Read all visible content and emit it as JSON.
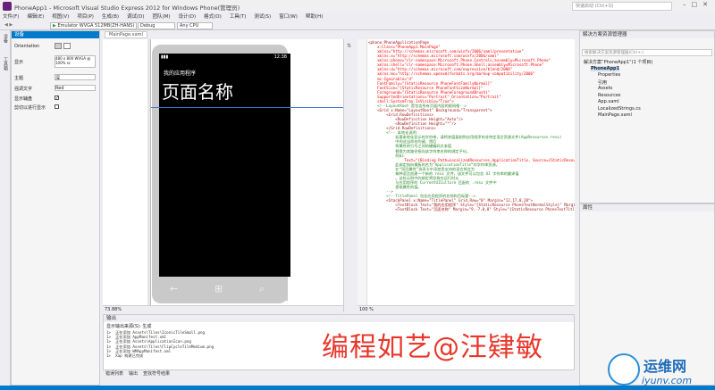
{
  "window": {
    "title": "PhoneApp1 - Microsoft Visual Studio Express 2012 for Windows Phone(管理员)",
    "quick_launch_placeholder": "快速启动 (Ctrl+Q)"
  },
  "menu": [
    "文件(F)",
    "编辑(E)",
    "视图(V)",
    "项目(P)",
    "生成(B)",
    "调试(D)",
    "团队(M)",
    "设计(D)",
    "格式(O)",
    "工具(T)",
    "测试(S)",
    "窗口(W)",
    "帮助(H)"
  ],
  "toolbar": {
    "emulator": "Emulator WVGA 512MB(ZH-HANS)",
    "config": "Debug",
    "platform": "Any CPU"
  },
  "left_strip": [
    "设备",
    "工具箱"
  ],
  "device_panel": {
    "header": "设备",
    "orientation_label": "Orientation",
    "rows": [
      {
        "label": "显示",
        "value": "480 x 800  WVGA @ 100% sc"
      },
      {
        "label": "主题",
        "value": "深"
      },
      {
        "label": "强调文字",
        "value": "Red"
      },
      {
        "label": "显示辅盘",
        "value": "",
        "checked": true
      },
      {
        "label": "剪切以进行显示",
        "value": "",
        "checked": false
      }
    ]
  },
  "tabs": {
    "designer_file": "MainPage.xaml"
  },
  "phone": {
    "status_time": "12:38",
    "app_name": "我的应用程序",
    "page_title": "页面名称",
    "nav_back": "←",
    "nav_start": "⊞",
    "nav_search": "⌕"
  },
  "designer": {
    "zoom": "73.88%"
  },
  "code": {
    "zoom": "100 %",
    "lines": [
      "<phone:PhoneApplicationPage",
      "    x:Class=\"PhoneApp1.MainPage\"",
      "    xmlns=\"http://schemas.microsoft.com/winfx/2006/xaml/presentation\"",
      "    xmlns:x=\"http://schemas.microsoft.com/winfx/2006/xaml\"",
      "    xmlns:phone=\"clr-namespace:Microsoft.Phone.Controls;assembly=Microsoft.Phone\"",
      "    xmlns:shell=\"clr-namespace:Microsoft.Phone.Shell;assembly=Microsoft.Phone\"",
      "    xmlns:d=\"http://schemas.microsoft.com/expression/blend/2008\"",
      "    xmlns:mc=\"http://schemas.openxmlformats.org/markup-compatibility/2006\"",
      "    mc:Ignorable=\"d\"",
      "    FontFamily=\"{StaticResource PhoneFontFamilyNormal}\"",
      "    FontSize=\"{StaticResource PhoneFontSizeNormal}\"",
      "    Foreground=\"{StaticResource PhoneForegroundBrush}\"",
      "    SupportedOrientations=\"Portrait\" Orientation=\"Portrait\"",
      "    shell:SystemTray.IsVisible=\"True\">",
      "",
      "    <!--LayoutRoot 是包含所有页面内容的根网格-->",
      "    <Grid x:Name=\"LayoutRoot\" Background=\"Transparent\">",
      "        <Grid.RowDefinitions>",
      "            <RowDefinition Height=\"Auto\"/>",
      "            <RowDefinition Height=\"*\"/>",
      "        </Grid.RowDefinitions>",
      "",
      "        <!-- 本地化说明:",
      "            若要本地化显示的字符串，请将其值复制到应用程序的非特定语言资源文件(AppResources.resx)",
      "            中的适当命名的键，然后",
      "            将属性的引号之间的硬编码文本值",
      "            替换为其路径指向该字符串名称的绑定子句。",
      "",
      "            例如:",
      "",
      "                Text=\"{Binding Path=LocalizedResources.ApplicationTitle, Source={StaticResource LocalizedStrings}}\"",
      "",
      "            此绑定指向模板的名为“ApplicationTitle”的字符串资源。",
      "",
      "            在“项目属性”选项卡中添加受支持的语言将会为",
      "            每种语言创建一个新的 resx 文件，该文件可以包含 UI 字符串的翻译值",
      "            。这些示例中的绑定将导致在运行时从",
      "            与应用程序的 CurrentUICulture 匹配的 .resx 文件中",
      "            提取属性的值。",
      "        -->",
      "",
      "        <!--TitlePanel 包含应用程序的名称和页标题-->",
      "        <StackPanel x:Name=\"TitlePanel\" Grid.Row=\"0\" Margin=\"12,17,0,28\">",
      "            <TextBlock Text=\"我的应用程序\" Style=\"{StaticResource PhoneTextNormalStyle}\" Margin=\"12,0\"/>",
      "            <TextBlock Text=\"页面名称\" Margin=\"9,-7,0,0\" Style=\"{StaticResource PhoneTextTitle1Style}\"/>"
    ]
  },
  "solution_explorer": {
    "header": "解决方案资源管理器",
    "search_placeholder": "搜索解决方案资源管理器(Ctrl+;)",
    "items": [
      {
        "label": "解决方案“PhoneApp1”(1 个项目)",
        "depth": 0
      },
      {
        "label": "PhoneApp1",
        "depth": 1
      },
      {
        "label": "Properties",
        "depth": 2
      },
      {
        "label": "引用",
        "depth": 2
      },
      {
        "label": "Assets",
        "depth": 2
      },
      {
        "label": "Resources",
        "depth": 2
      },
      {
        "label": "App.xaml",
        "depth": 2
      },
      {
        "label": "LocalizedStrings.cs",
        "depth": 2
      },
      {
        "label": "MainPage.xaml",
        "depth": 2
      }
    ]
  },
  "properties_panel": {
    "header": "属性"
  },
  "output": {
    "header": "输出",
    "source_label": "显示输出来源(S): 生成",
    "lines": [
      "1>  正在添加 Assets\\Tiles\\IconicTileSmall.png",
      "1>  正在添加 AppManifest.xml",
      "1>  正在添加 Assets\\ApplicationIcon.png",
      "1>  正在添加 Assets\\Tiles\\FlipCycleTileMedium.png",
      "1>  正在添加 WMAppManifest.xml",
      "1>  Xap 构建已完成"
    ]
  },
  "bottom_tabs": [
    "错误列表",
    "输出",
    "查找符号结果"
  ],
  "overlay": {
    "caption": "编程如艺@汪肄敏"
  },
  "watermark": {
    "name": "运维网",
    "url": "iyunv.com"
  }
}
